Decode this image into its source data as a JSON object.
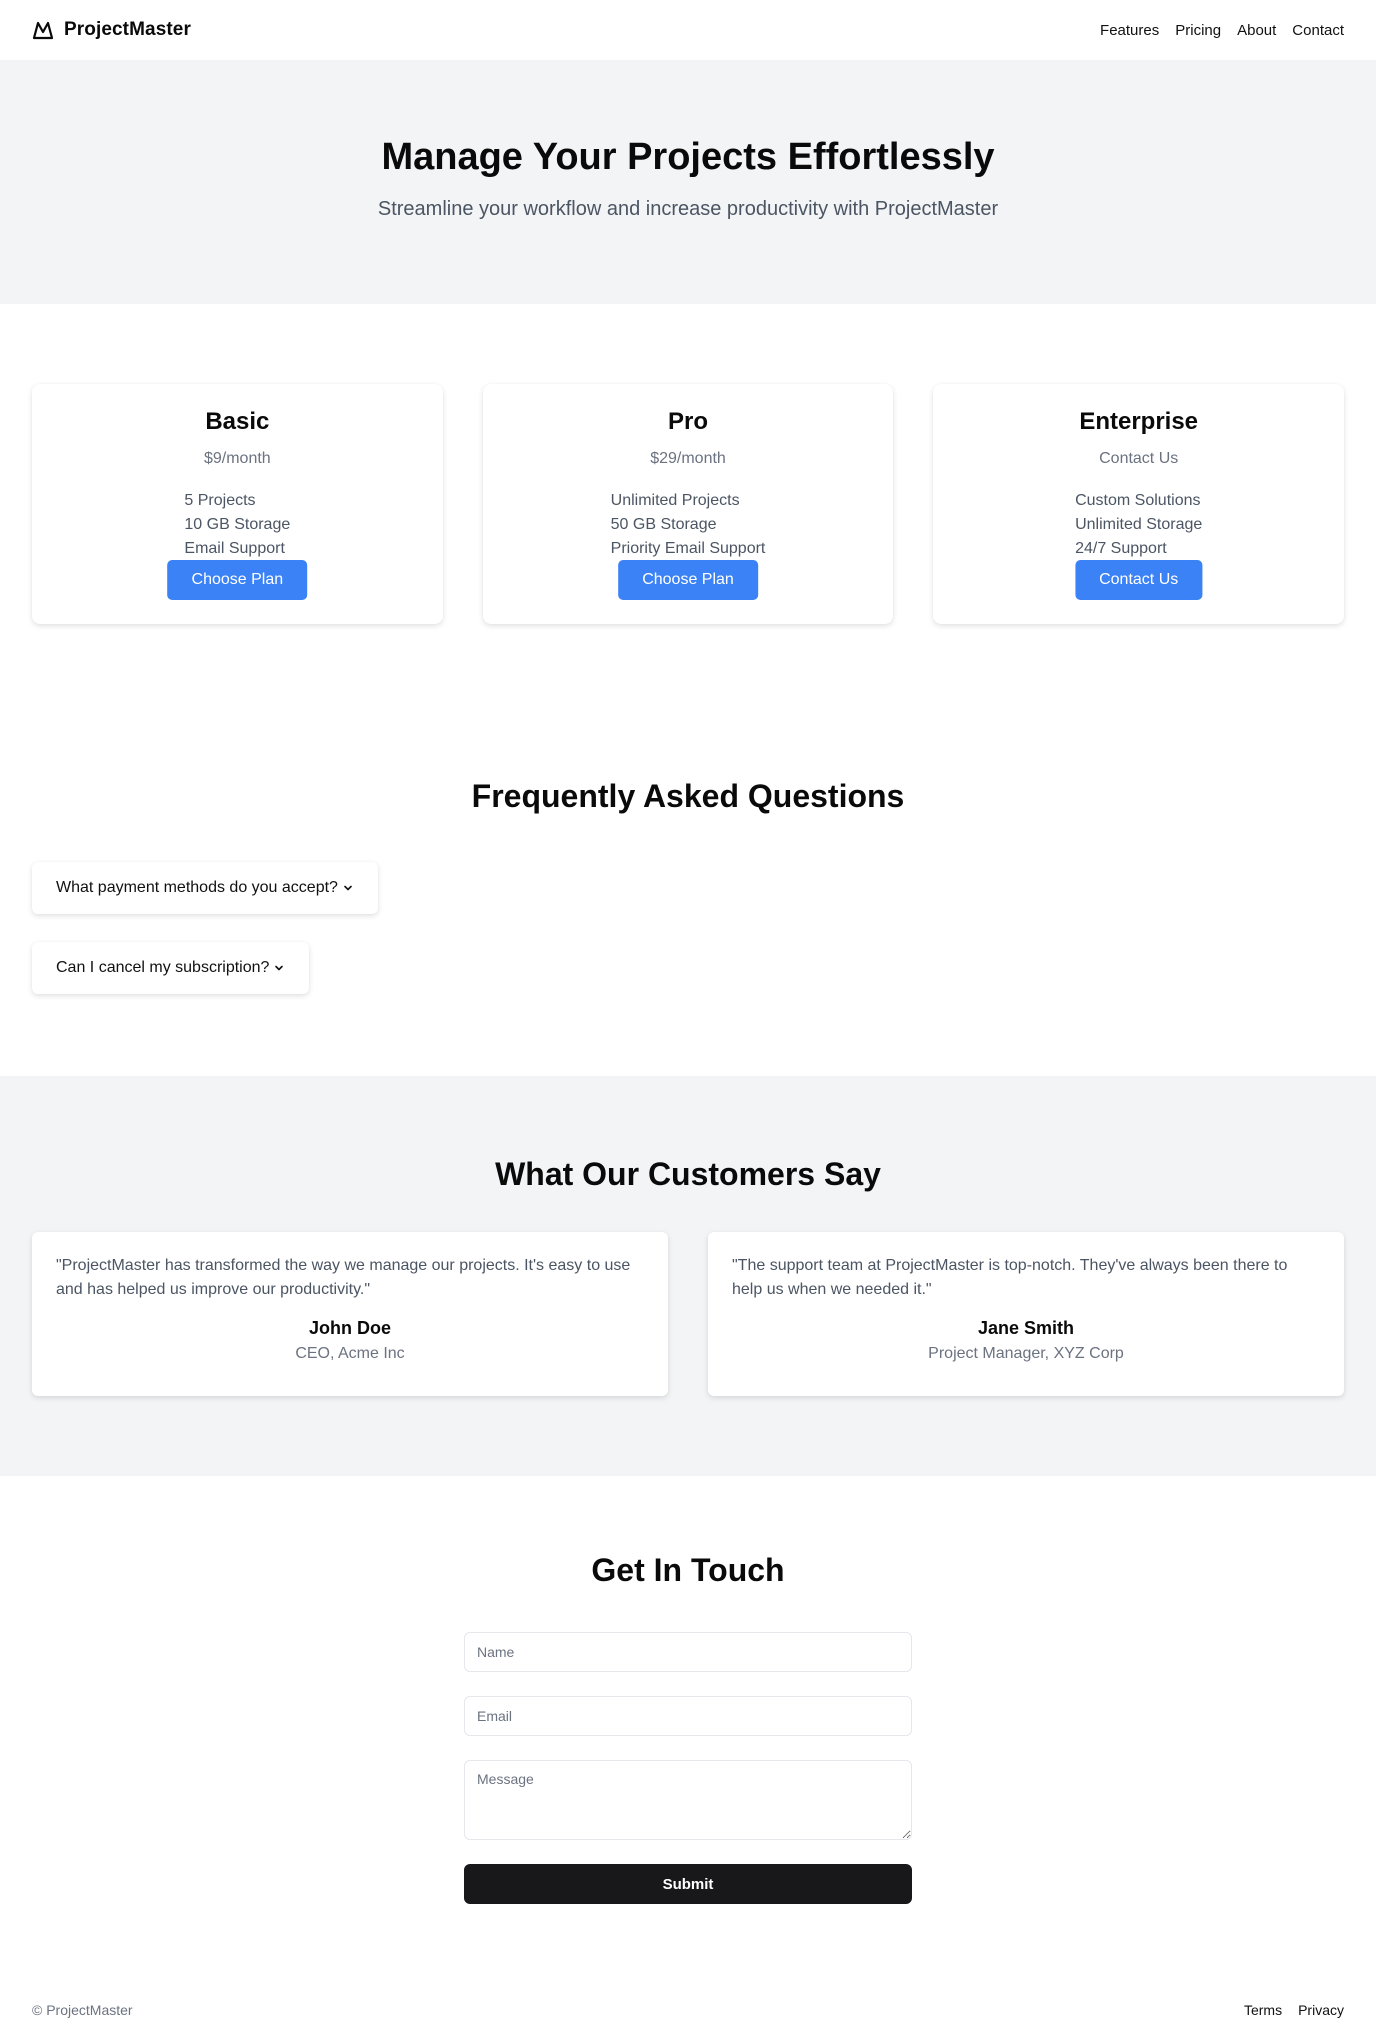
{
  "header": {
    "brand": "ProjectMaster",
    "logo_icon": "mountain-icon",
    "nav": [
      {
        "label": "Features"
      },
      {
        "label": "Pricing"
      },
      {
        "label": "About"
      },
      {
        "label": "Contact"
      }
    ]
  },
  "hero": {
    "title": "Manage Your Projects Effortlessly",
    "subtitle": "Streamline your workflow and increase productivity with ProjectMaster"
  },
  "pricing": {
    "accent_color": "#3b82f6",
    "plans": [
      {
        "name": "Basic",
        "price": "$9/month",
        "features": [
          "5 Projects",
          "10 GB Storage",
          "Email Support"
        ],
        "button": "Choose Plan"
      },
      {
        "name": "Pro",
        "price": "$29/month",
        "features": [
          "Unlimited Projects",
          "50 GB Storage",
          "Priority Email Support"
        ],
        "button": "Choose Plan"
      },
      {
        "name": "Enterprise",
        "price": "Contact Us",
        "features": [
          "Custom Solutions",
          "Unlimited Storage",
          "24/7 Support"
        ],
        "button": "Contact Us"
      }
    ]
  },
  "faq": {
    "title": "Frequently Asked Questions",
    "items": [
      {
        "question": "What payment methods do you accept?",
        "icon": "chevron-down-icon"
      },
      {
        "question": "Can I cancel my subscription?",
        "icon": "chevron-down-icon"
      }
    ]
  },
  "testimonials": {
    "title": "What Our Customers Say",
    "items": [
      {
        "quote": "\"ProjectMaster has transformed the way we manage our projects. It's easy to use and has helped us improve our productivity.\"",
        "name": "John Doe",
        "role": "CEO, Acme Inc"
      },
      {
        "quote": "\"The support team at ProjectMaster is top-notch. They've always been there to help us when we needed it.\"",
        "name": "Jane Smith",
        "role": "Project Manager, XYZ Corp"
      }
    ]
  },
  "contact": {
    "title": "Get In Touch",
    "name_placeholder": "Name",
    "email_placeholder": "Email",
    "message_placeholder": "Message",
    "submit": "Submit"
  },
  "footer": {
    "copyright": "© ProjectMaster",
    "links": [
      {
        "label": "Terms"
      },
      {
        "label": "Privacy"
      }
    ]
  }
}
